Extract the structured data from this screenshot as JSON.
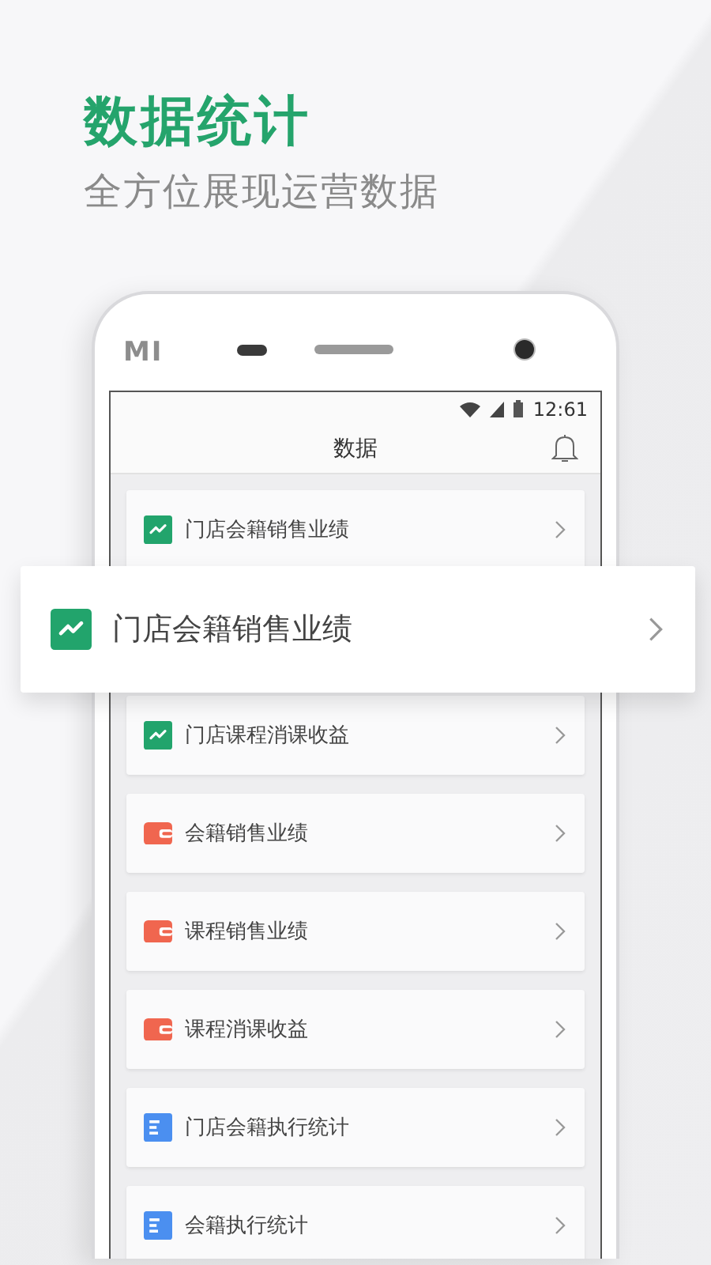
{
  "headline": "数据统计",
  "subtitle": "全方位展现运营数据",
  "phone": {
    "brand": "MI",
    "time": "12:61",
    "title": "数据"
  },
  "items": [
    {
      "kind": "trend",
      "label": "门店会籍销售业绩"
    },
    {
      "kind": "trend",
      "label": "门店课程消课收益"
    },
    {
      "kind": "wallet",
      "label": "会籍销售业绩"
    },
    {
      "kind": "wallet",
      "label": "课程销售业绩"
    },
    {
      "kind": "wallet",
      "label": "课程消课收益"
    },
    {
      "kind": "list",
      "label": "门店会籍执行统计"
    },
    {
      "kind": "list",
      "label": "会籍执行统计"
    }
  ],
  "popup": {
    "kind": "trend",
    "label": "门店会籍销售业绩"
  }
}
